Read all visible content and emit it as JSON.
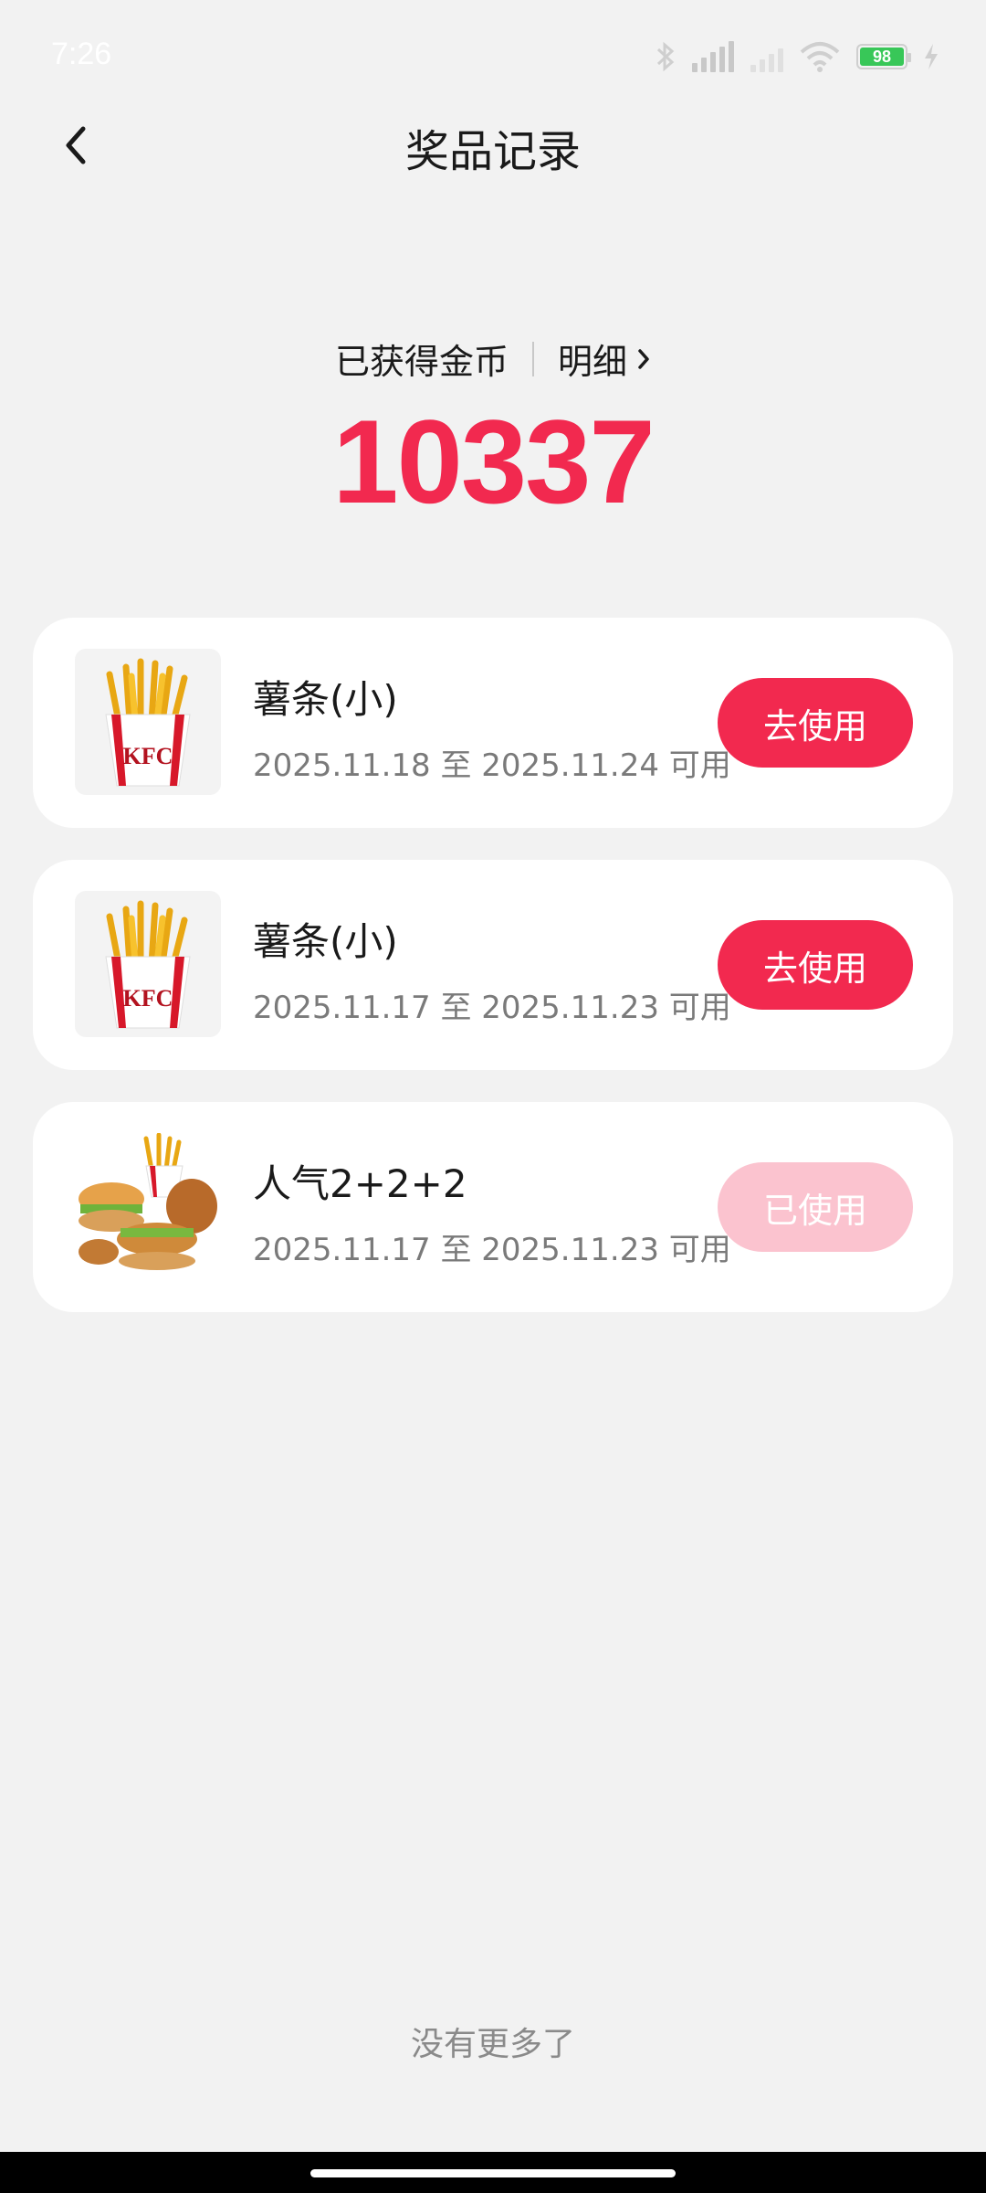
{
  "status_bar": {
    "time": "7:26",
    "battery": "98",
    "icons": [
      "bluetooth-icon",
      "hd-signal-icon",
      "signal-icon",
      "wifi-icon",
      "battery-icon",
      "charging-icon"
    ]
  },
  "header": {
    "title": "奖品记录",
    "back_icon": "chevron-left-icon"
  },
  "coins": {
    "label": "已获得金币",
    "detail_label": "明细",
    "value": "10337"
  },
  "colors": {
    "accent": "#f2294f",
    "accent_disabled": "#fbc3cf",
    "background": "#f2f2f2",
    "card": "#ffffff"
  },
  "prizes": [
    {
      "name": "薯条(小)",
      "validity": "2025.11.18 至 2025.11.24 可用",
      "button": "去使用",
      "used": false,
      "image": "kfc-fries-image"
    },
    {
      "name": "薯条(小)",
      "validity": "2025.11.17 至 2025.11.23 可用",
      "button": "去使用",
      "used": false,
      "image": "kfc-fries-image"
    },
    {
      "name": "人气2+2+2",
      "validity": "2025.11.17 至 2025.11.23 可用",
      "button": "已使用",
      "used": true,
      "image": "kfc-combo-image"
    }
  ],
  "footer": {
    "no_more": "没有更多了"
  }
}
